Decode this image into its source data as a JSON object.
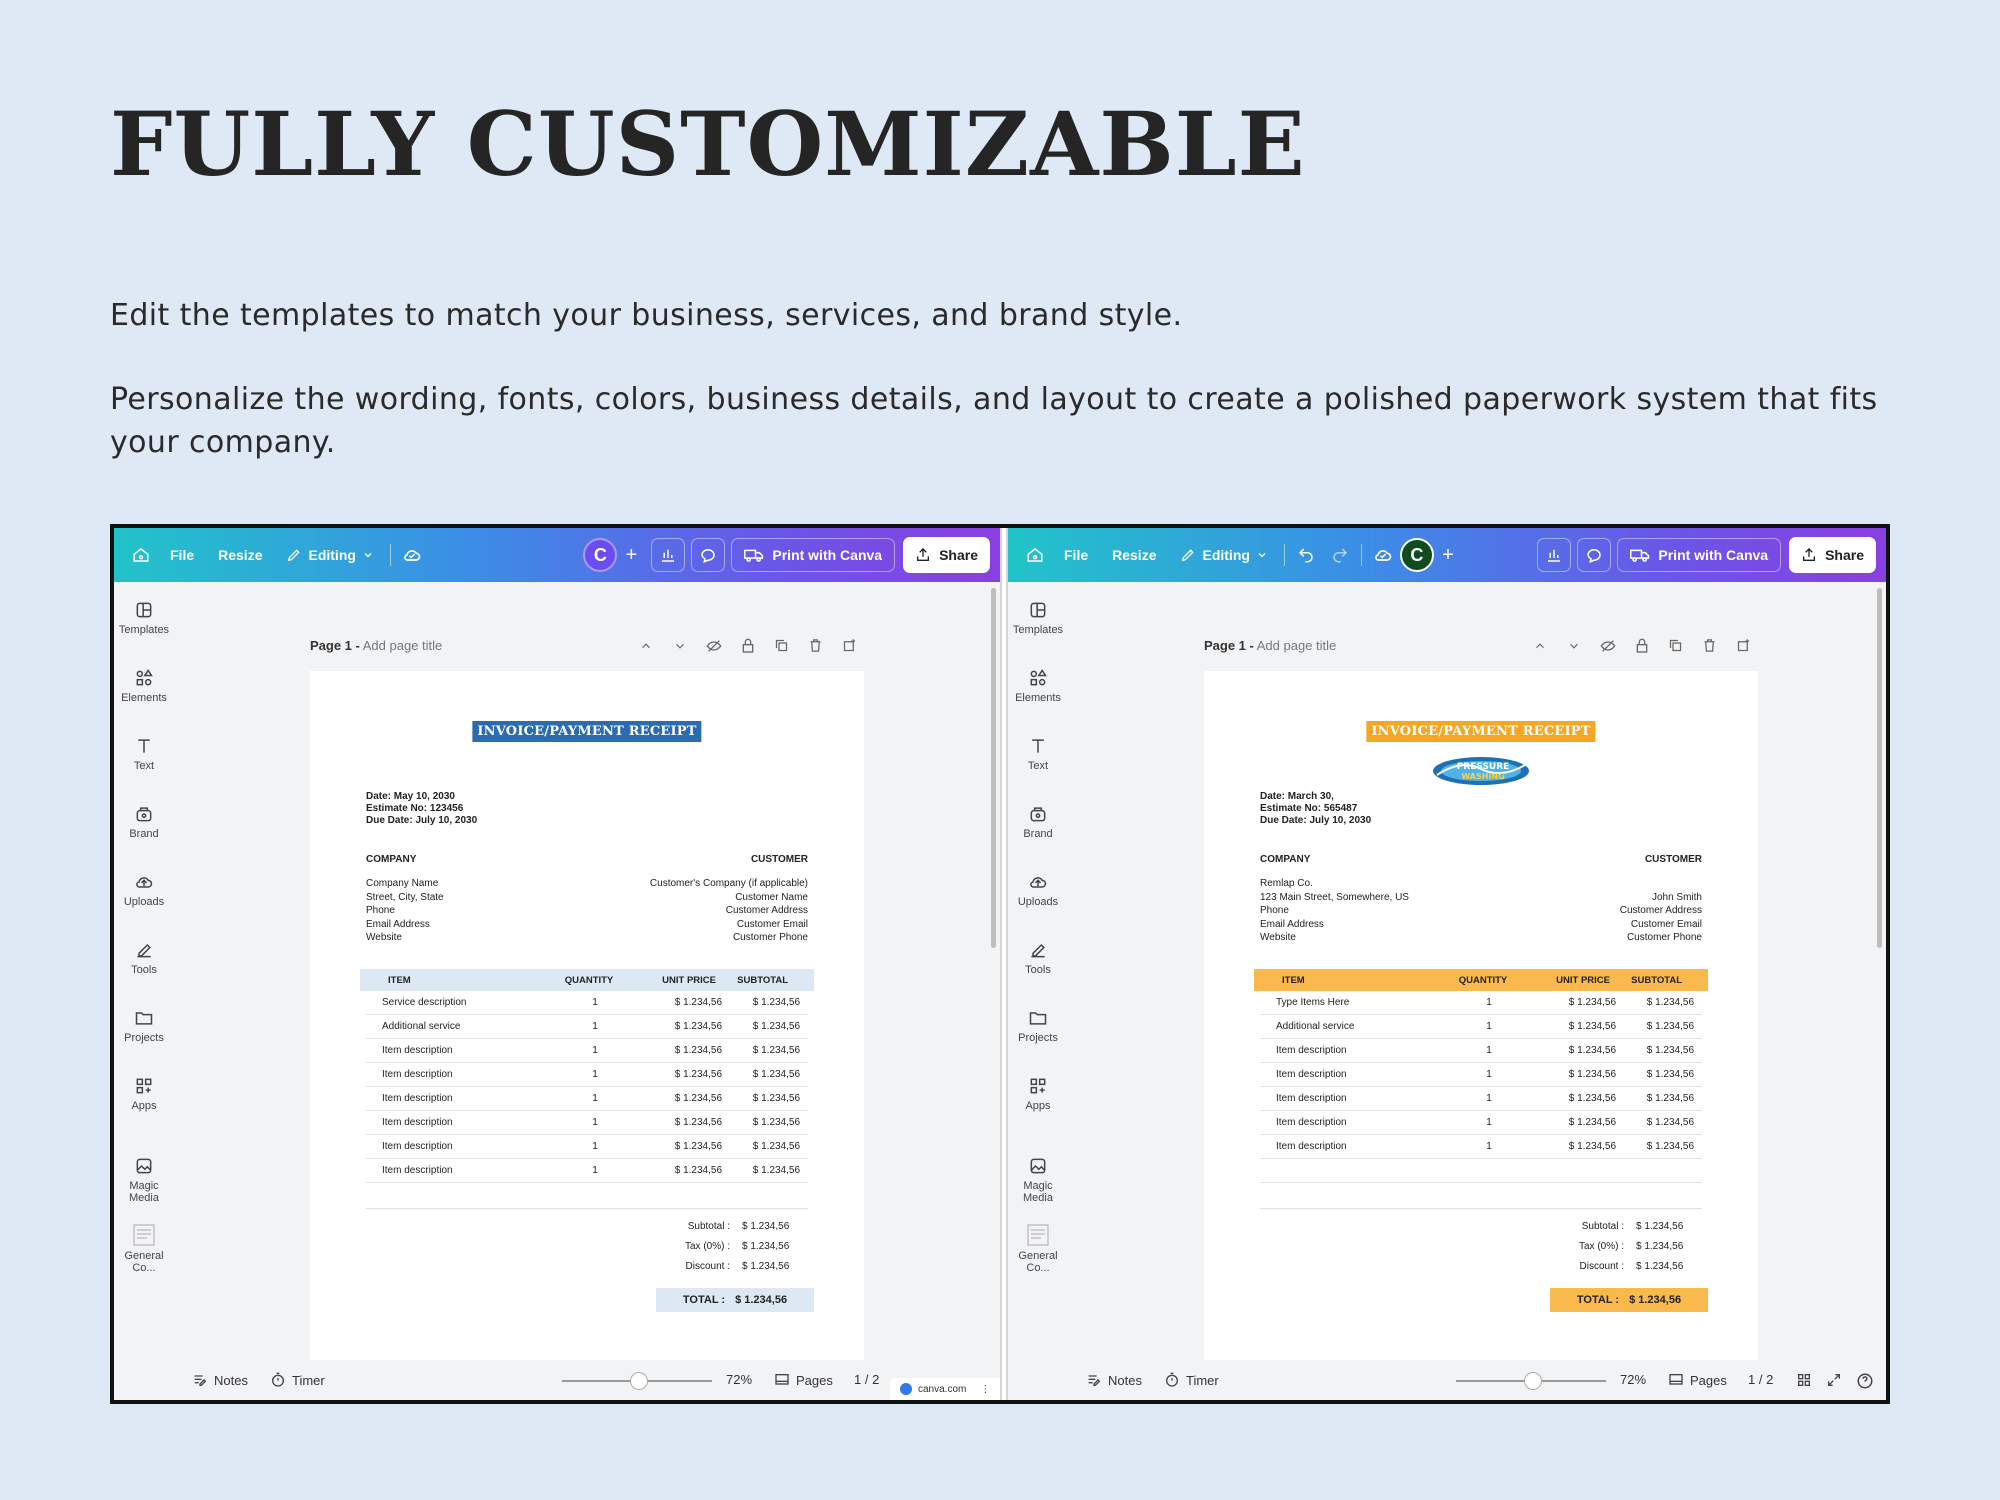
{
  "heading": "FULLY CUSTOMIZABLE",
  "paragraph1": "Edit the templates to match your business, services, and brand style.",
  "paragraph2": "Personalize the wording, fonts, colors, business details, and layout to create a polished paperwork system that fits your company.",
  "toolbar": {
    "file": "File",
    "resize": "Resize",
    "editing": "Editing",
    "print": "Print with Canva",
    "share": "Share"
  },
  "sidebar": {
    "items": [
      "Templates",
      "Elements",
      "Text",
      "Brand",
      "Uploads",
      "Tools",
      "Projects",
      "Apps",
      "Magic Media",
      "General Co..."
    ]
  },
  "pagebar": {
    "page": "Page 1 -",
    "add_title": "Add page title"
  },
  "bottombar": {
    "notes": "Notes",
    "timer": "Timer",
    "zoom": "72%",
    "pages": "Pages",
    "page_count": "1 / 2",
    "canva_badge": "canva.com"
  },
  "left_invoice": {
    "title": "INVOICE/PAYMENT RECEIPT",
    "accent": "#2b6cb0",
    "table_header_bg": "#dce8f4",
    "date": "Date: May 10, 2030",
    "estimate": "Estimate No: 123456",
    "due": "Due Date: July 10, 2030",
    "company_h": "COMPANY",
    "customer_h": "CUSTOMER",
    "company": [
      "Company Name",
      "Street, City, State",
      "Phone",
      "Email Address",
      "Website"
    ],
    "customer": [
      "Customer's Company (if applicable)",
      "Customer Name",
      "Customer Address",
      "Customer Email",
      "Customer Phone"
    ],
    "headers": [
      "ITEM",
      "QUANTITY",
      "UNIT PRICE",
      "SUBTOTAL"
    ],
    "rows": [
      [
        "Service description",
        "1",
        "$ 1.234,56",
        "$ 1.234,56"
      ],
      [
        "Additional service",
        "1",
        "$ 1.234,56",
        "$ 1.234,56"
      ],
      [
        "Item description",
        "1",
        "$ 1.234,56",
        "$ 1.234,56"
      ],
      [
        "Item description",
        "1",
        "$ 1.234,56",
        "$ 1.234,56"
      ],
      [
        "Item description",
        "1",
        "$ 1.234,56",
        "$ 1.234,56"
      ],
      [
        "Item description",
        "1",
        "$ 1.234,56",
        "$ 1.234,56"
      ],
      [
        "Item description",
        "1",
        "$ 1.234,56",
        "$ 1.234,56"
      ],
      [
        "Item description",
        "1",
        "$ 1.234,56",
        "$ 1.234,56"
      ]
    ],
    "subtotal_lbl": "Subtotal :",
    "subtotal": "$ 1.234,56",
    "tax_lbl": "Tax (0%) :",
    "tax": "$ 1.234,56",
    "discount_lbl": "Discount :",
    "discount": "$ 1.234,56",
    "total_lbl": "TOTAL :",
    "total": "$ 1.234,56"
  },
  "right_invoice": {
    "title": "INVOICE/PAYMENT RECEIPT",
    "accent": "#f5a623",
    "table_header_bg": "#f9b94d",
    "logo_text": "PRESSURE WASHING",
    "date": "Date: March 30,",
    "estimate": "Estimate No: 565487",
    "due": "Due Date: July 10, 2030",
    "company_h": "COMPANY",
    "customer_h": "CUSTOMER",
    "company": [
      "Remlap Co.",
      "123 Main Street, Somewhere, US",
      "Phone",
      "Email Address",
      "Website"
    ],
    "customer": [
      "",
      "John Smith",
      "Customer Address",
      "Customer Email",
      "Customer Phone"
    ],
    "headers": [
      "ITEM",
      "QUANTITY",
      "UNIT PRICE",
      "SUBTOTAL"
    ],
    "rows": [
      [
        "Type Items Here",
        "1",
        "$ 1.234,56",
        "$ 1.234,56"
      ],
      [
        "Additional service",
        "1",
        "$ 1.234,56",
        "$ 1.234,56"
      ],
      [
        "Item description",
        "1",
        "$ 1.234,56",
        "$ 1.234,56"
      ],
      [
        "Item description",
        "1",
        "$ 1.234,56",
        "$ 1.234,56"
      ],
      [
        "Item description",
        "1",
        "$ 1.234,56",
        "$ 1.234,56"
      ],
      [
        "Item description",
        "1",
        "$ 1.234,56",
        "$ 1.234,56"
      ],
      [
        "Item description",
        "1",
        "$ 1.234,56",
        "$ 1.234,56"
      ]
    ],
    "subtotal_lbl": "Subtotal :",
    "subtotal": "$ 1.234,56",
    "tax_lbl": "Tax (0%) :",
    "tax": "$ 1.234,56",
    "discount_lbl": "Discount :",
    "discount": "$ 1.234,56",
    "total_lbl": "TOTAL :",
    "total": "$ 1.234,56"
  }
}
